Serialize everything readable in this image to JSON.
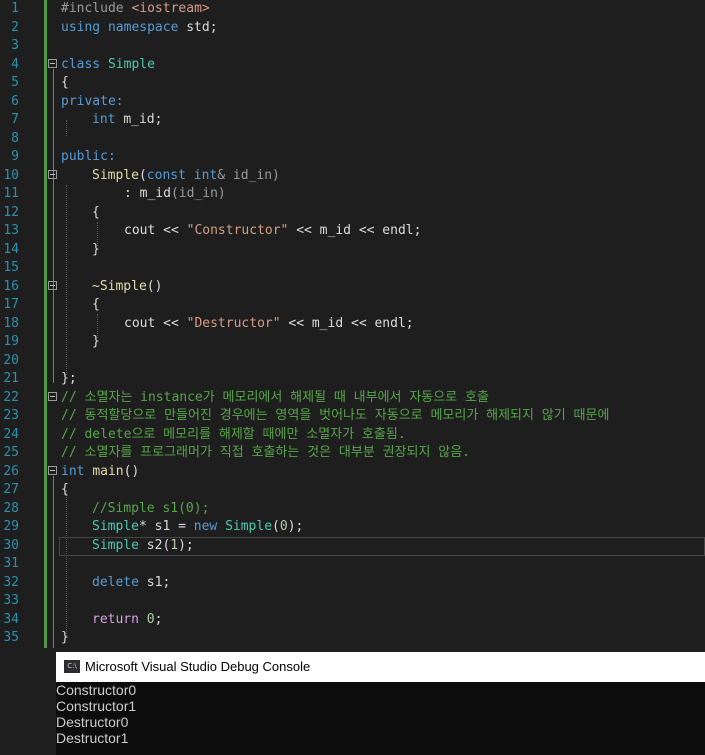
{
  "editor": {
    "line_numbers": [
      "1",
      "2",
      "3",
      "4",
      "5",
      "6",
      "7",
      "8",
      "9",
      "10",
      "11",
      "12",
      "13",
      "14",
      "15",
      "16",
      "17",
      "18",
      "19",
      "20",
      "21",
      "22",
      "23",
      "24",
      "25",
      "26",
      "27",
      "28",
      "29",
      "30",
      "31",
      "32",
      "33",
      "34",
      "35"
    ],
    "lines": {
      "l1": {
        "a": "#include ",
        "b": "<iostream>"
      },
      "l2": {
        "a": "using namespace ",
        "b": "std;"
      },
      "l4": {
        "a": "class ",
        "b": "Simple"
      },
      "l5": {
        "a": "{"
      },
      "l6": {
        "a": "private:"
      },
      "l7": {
        "a": "int ",
        "b": "m_id;"
      },
      "l9": {
        "a": "public:"
      },
      "l10": {
        "a": "Simple",
        "b": "(",
        "c": "const int",
        "d": "& id_in)"
      },
      "l11": {
        "a": ": m_id",
        "b": "(id_in)"
      },
      "l12": {
        "a": "{"
      },
      "l13": {
        "a": "cout << ",
        "b": "\"Constructor\"",
        "c": " << m_id << endl;"
      },
      "l14": {
        "a": "}"
      },
      "l16": {
        "a": "~Simple",
        "b": "()"
      },
      "l17": {
        "a": "{"
      },
      "l18": {
        "a": "cout << ",
        "b": "\"Destructor\"",
        "c": " << m_id << endl;"
      },
      "l19": {
        "a": "}"
      },
      "l21": {
        "a": "};"
      },
      "l22": {
        "a": "// 소멸자는 instance가 메모리에서 해제될 때 내부에서 자동으로 호출"
      },
      "l23": {
        "a": "// 동적할당으로 만들어진 경우에는 영역을 벗어나도 자동으로 메모리가 해제되지 않기 때문에"
      },
      "l24": {
        "a": "// delete으로 메모리를 해제할 때에만 소멸자가 호출됨."
      },
      "l25": {
        "a": "// 소멸자를 프로그래머가 직접 호출하는 것은 대부분 권장되지 않음."
      },
      "l26": {
        "a": "int ",
        "b": "main",
        "c": "()"
      },
      "l27": {
        "a": "{"
      },
      "l28": {
        "a": "//Simple s1(0);"
      },
      "l29": {
        "a": "Simple",
        "b": "* ",
        "c": "s1",
        "d": " = ",
        "e": "new ",
        "f": "Simple",
        "g": "(",
        "h": "0",
        "i": ");"
      },
      "l30": {
        "a": "Simple ",
        "b": "s2",
        "c": "(",
        "d": "1",
        "e": ");"
      },
      "l32": {
        "a": "delete ",
        "b": "s1;"
      },
      "l34": {
        "a": "return ",
        "b": "0",
        "c": ";"
      },
      "l35": {
        "a": "}"
      }
    }
  },
  "console": {
    "title": "Microsoft Visual Studio Debug Console",
    "icon_label": "C:\\",
    "output": [
      "Constructor0",
      "Constructor1",
      "Destructor0",
      "Destructor1"
    ]
  }
}
